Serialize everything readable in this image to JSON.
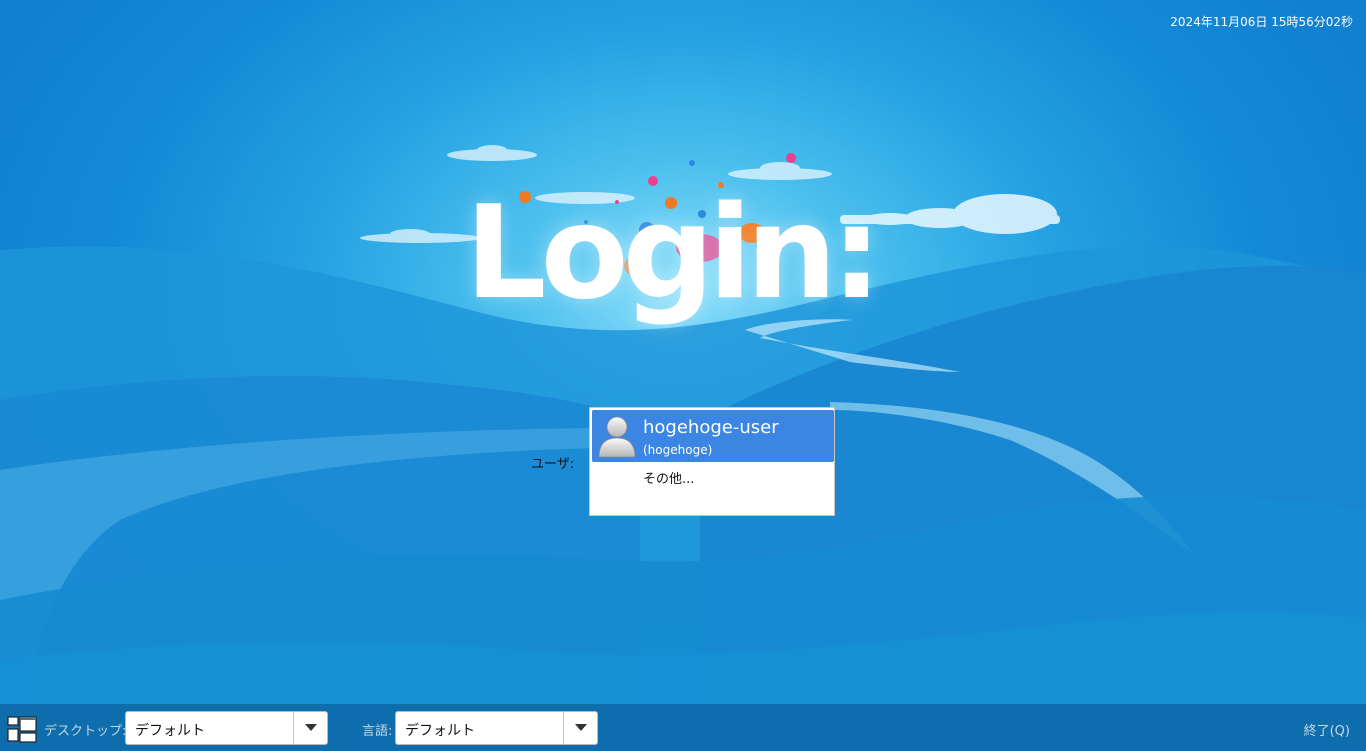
{
  "clock": "2024年11月06日 15時56分02秒",
  "title": "Login:",
  "user_prompt_label": "ユーザ:",
  "users": [
    {
      "name": "hogehoge-user",
      "login": "(hogehoge)",
      "selected": true,
      "icon": "user-avatar-icon"
    }
  ],
  "other_user_label": "その他...",
  "bottom": {
    "session_icon": "desktop-session-icon",
    "desktop_label": "デスクトップ:",
    "desktop_value": "デフォルト",
    "language_label": "言語:",
    "language_value": "デフォルト",
    "quit_label": "終了(Q)"
  },
  "colors": {
    "selection": "#3b86e3",
    "background_center": "#8fe0fb",
    "background_edge": "#0f75c9"
  }
}
